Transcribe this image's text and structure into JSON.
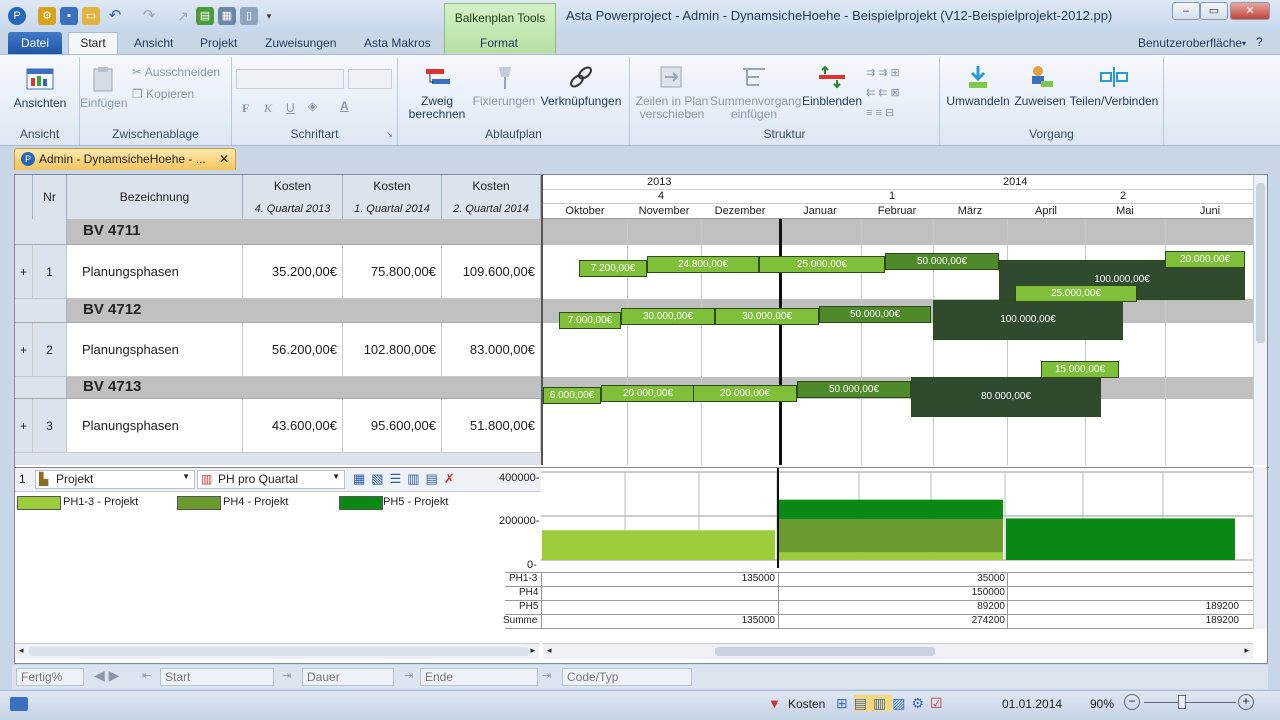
{
  "window": {
    "title": "Asta Powerproject - Admin - DynamsicheHoehe - Beispielprojekt (V12-Beispielprojekt-2012.pp)",
    "context_tab": "Balkenplan Tools"
  },
  "tabs": {
    "datei": "Datei",
    "start": "Start",
    "ansicht": "Ansicht",
    "projekt": "Projekt",
    "zuweisungen": "Zuweisungen",
    "makros": "Asta Makros",
    "format": "Format",
    "ui": "Benutzeroberfläche"
  },
  "ribbon": {
    "ansichten": {
      "btn": "Ansichten",
      "group": "Ansicht"
    },
    "clipboard": {
      "paste": "Einfügen",
      "cut": "Ausschneiden",
      "copy": "Kopieren",
      "group": "Zwischenablage"
    },
    "font": {
      "group": "Schriftart",
      "bold": "F",
      "italic": "K",
      "underline": "U"
    },
    "ablauf": {
      "zweig1": "Zweig",
      "zweig2": "berechnen",
      "fix": "Fixierungen",
      "links": "Verknüpfungen",
      "group": "Ablaufplan"
    },
    "struktur": {
      "zeilen1": "Zeilen in Plan",
      "zeilen2": "verschieben",
      "summe1": "Summenvorgang",
      "summe2": "einfügen",
      "einblenden": "Einblenden",
      "group": "Struktur"
    },
    "vorgang": {
      "umwandeln": "Umwandeln",
      "zuweisen": "Zuweisen",
      "teilen": "Teilen/Verbinden",
      "group": "Vorgang"
    }
  },
  "doc_tab": "Admin - DynamsicheHoehe - ...",
  "grid": {
    "headers": {
      "nr": "Nr",
      "bez": "Bezeichnung",
      "k1": "Kosten",
      "k1s": "4. Quartal 2013",
      "k2": "Kosten",
      "k2s": "1. Quartal 2014",
      "k3": "Kosten",
      "k3s": "2. Quartal 2014"
    },
    "groups": [
      {
        "name": "BV 4711",
        "plus": "+",
        "nr": "1",
        "bez": "Planungsphasen",
        "k1": "35.200,00€",
        "k2": "75.800,00€",
        "k3": "109.600,00€"
      },
      {
        "name": "BV 4712",
        "plus": "+",
        "nr": "2",
        "bez": "Planungsphasen",
        "k1": "56.200,00€",
        "k2": "102.800,00€",
        "k3": "83.000,00€"
      },
      {
        "name": "BV 4713",
        "plus": "+",
        "nr": "3",
        "bez": "Planungsphasen",
        "k1": "43.600,00€",
        "k2": "95.600,00€",
        "k3": "51.800,00€"
      }
    ]
  },
  "timescale": {
    "years": [
      "2013",
      "2014"
    ],
    "quarters": [
      "4",
      "1",
      "2"
    ],
    "months": [
      "Oktober",
      "November",
      "Dezember",
      "Januar",
      "Februar",
      "März",
      "April",
      "Mai",
      "Juni"
    ]
  },
  "bars": {
    "r1": [
      "7.200,00€",
      "24.800,00€",
      "25.000,00€",
      "50.000,00€",
      "100.000,00€",
      "20.000,00€"
    ],
    "r2": [
      "7.000,00€",
      "30.000,00€",
      "30.000,00€",
      "50.000,00€",
      "100.000,00€",
      "25.000,00€"
    ],
    "r3": [
      "6.000,00€",
      "20.000,00€",
      "20.000,00€",
      "50.000,00€",
      "80.000,00€",
      "15.000,00€"
    ]
  },
  "histogram": {
    "row": "1",
    "sel1": "Projekt",
    "sel2": "PH pro Quartal",
    "legend": [
      "PH1-3 - Projekt",
      "PH4 - Projekt",
      "PH5 - Projekt"
    ],
    "yticks": [
      "400000-",
      "200000-",
      "0-"
    ],
    "table_labels": [
      "PH1-3",
      "PH4",
      "PH5",
      "Summe"
    ],
    "ph13": [
      "135000",
      "35000",
      ""
    ],
    "ph4": [
      "",
      "150000",
      ""
    ],
    "ph5": [
      "",
      "89200",
      "189200"
    ],
    "summe": [
      "135000",
      "274200",
      "189200"
    ]
  },
  "chart_data": {
    "type": "bar",
    "categories": [
      "4. Quartal 2013",
      "1. Quartal 2014",
      "2. Quartal 2014"
    ],
    "series": [
      {
        "name": "PH1-3 - Projekt",
        "values": [
          135000,
          35000,
          0
        ]
      },
      {
        "name": "PH4 - Projekt",
        "values": [
          0,
          150000,
          0
        ]
      },
      {
        "name": "PH5 - Projekt",
        "values": [
          0,
          89200,
          189200
        ]
      }
    ],
    "ylim": [
      0,
      400000
    ],
    "colors": [
      "#9ccc3a",
      "#6b9a2e",
      "#0a8a14"
    ]
  },
  "fields": {
    "fertig": "Fertig%",
    "start": "Start",
    "dauer": "Dauer",
    "ende": "Ende",
    "code": "Code/Typ"
  },
  "status": {
    "kosten": "Kosten",
    "date": "01.01.2014",
    "zoom": "90%"
  }
}
